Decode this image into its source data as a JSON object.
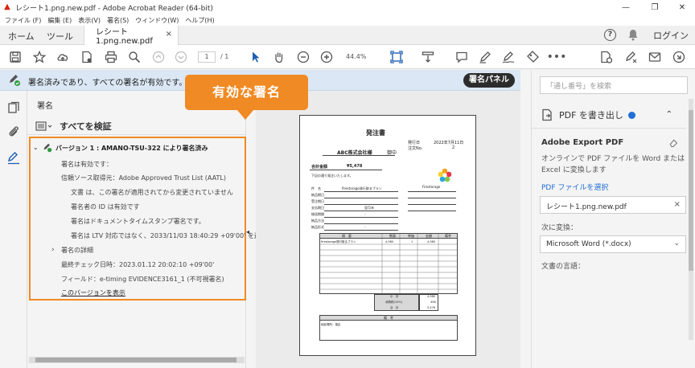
{
  "window": {
    "title": "レシート1.png.new.pdf - Adobe Acrobat Reader (64-bit)",
    "minimize": "—",
    "restore": "❐",
    "close": "✕"
  },
  "menu": [
    "ファイル (F)",
    "編集 (E)",
    "表示(V)",
    "署名(S)",
    "ウィンドウ(W)",
    "ヘルプ(H)"
  ],
  "tabs": {
    "home": "ホーム",
    "tools": "ツール",
    "doc": "レシート1.png.new.pdf",
    "doc_close": "×",
    "help": "?",
    "login": "ログイン"
  },
  "toolbar": {
    "page_current": "1",
    "page_total": "/ 1",
    "zoom": "44.4%"
  },
  "signature_bar": {
    "message": "署名済みであり、すべての署名が有効です。",
    "panel_button": "署名パネル"
  },
  "callout": {
    "text": "有効な署名"
  },
  "sig_panel": {
    "title": "署名",
    "verify_all": "すべてを検証",
    "version": "バージョン 1 : AMANO-TSU-322 により署名済み",
    "lines": [
      "署名は有効です：",
      "信頼ソース取得元：Adobe Approved Trust List (AATL)",
      "文書 は、この署名が適用されてから変更されていません",
      "署名者の ID は有効です",
      "署名はドキュメントタイムスタンプ署名です。",
      "署名は LTV 対応ではなく、2033/11/03 18:40:29 +09'00' を過ぎるとそ"
    ],
    "details": "署名の詳細",
    "last_check": "最終チェック日時：2023.01.12 20:02:10 +09'00'",
    "field": "フィールド：e-timing EVIDENCE3161_1 (不可視署名)",
    "show_version": "このバージョンを表示"
  },
  "document": {
    "heading": "発注書",
    "issue_label": "発行日",
    "issue_date": "2022年7月11日",
    "order_label": "注文No.",
    "order_no": "2",
    "company": "ABC株式会社様",
    "honorific": "御中",
    "total_label": "合計金額",
    "total_value": "¥5,478",
    "note": "下記の通り発注いたします。",
    "brand": "Firestorage",
    "fields": [
      "件　名",
      "納品期日",
      "受注期日",
      "支払期日",
      "検収期間",
      "納品方法",
      "納品形式"
    ],
    "subject_value": "firestorage発行取るプラン",
    "pay_value": "翌月末",
    "dash": "-",
    "table_headers": [
      "摘　要",
      "数量",
      "単価",
      "金額",
      "備考"
    ],
    "row1": [
      "firestorage発行取るプラン",
      "4,980",
      "1",
      "4,980"
    ],
    "subtotal_label": "小　計",
    "subtotal": "4,980",
    "tax_label": "消費税(10%)",
    "tax": "498",
    "sum_label": "合　計",
    "sum": "5,478",
    "remarks_title": "備　考",
    "remarks_value": "納品場所：指定"
  },
  "right_panel": {
    "search_placeholder": "「通し番号」を検索",
    "export_title": "PDF を書き出し",
    "collapse": "⌃",
    "export_heading": "Adobe Export PDF",
    "export_desc": "オンラインで PDF ファイルを Word または Excel に変換します",
    "select_link": "PDF ファイルを選択",
    "file_name": "レシート1.png.new.pdf",
    "file_remove": "×",
    "convert_label": "次に変換：",
    "convert_value": "Microsoft Word (*.docx)",
    "language_label": "文書の言語：",
    "colors": {
      "accent": "#f08a24",
      "link": "#1f6fd6",
      "sigbar": "#dbe7f4"
    }
  }
}
